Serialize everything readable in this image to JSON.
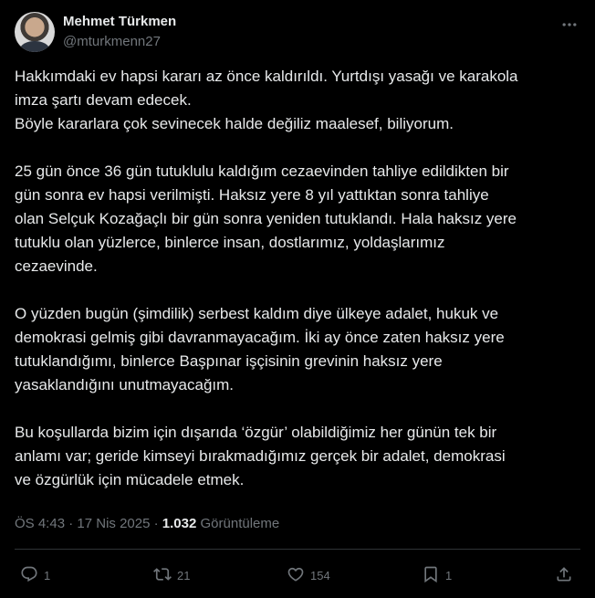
{
  "author": {
    "name": "Mehmet Türkmen",
    "handle": "@mturkmenn27"
  },
  "tweet": {
    "paragraphs": [
      "Hakkımdaki ev hapsi kararı az önce kaldırıldı. Yurtdışı yasağı ve karakola\nimza şartı devam edecek.\nBöyle kararlara çok sevinecek halde değiliz maalesef, biliyorum.",
      "25 gün önce 36 gün tutuklulu kaldığım cezaevinden tahliye edildikten bir\ngün sonra ev hapsi verilmişti. Haksız yere 8 yıl yattıktan sonra tahliye\nolan Selçuk Kozağaçlı bir gün sonra yeniden tutuklandı. Hala haksız yere\ntutuklu olan yüzlerce, binlerce insan, dostlarımız, yoldaşlarımız\ncezaevinde.",
      "O yüzden bugün (şimdilik) serbest kaldım diye ülkeye adalet, hukuk ve\ndemokrasi gelmiş gibi davranmayacağım. İki ay önce zaten haksız yere\ntutuklandığımı, binlerce Başpınar işçisinin grevinin haksız yere\nyasaklandığını unutmayacağım.",
      "Bu koşullarda bizim için dışarıda ‘özgür’ olabildiğimiz her günün tek bir\nanlamı var; geride kimseyi bırakmadığımız gerçek bir adalet,  demokrasi\nve özgürlük için mücadele etmek."
    ],
    "time": "ÖS 4:43",
    "date": "17 Nis 2025",
    "separator": "·",
    "views_count": "1.032",
    "views_label": "Görüntüleme"
  },
  "actions": {
    "reply": {
      "icon": "reply-icon",
      "count": "1"
    },
    "retweet": {
      "icon": "retweet-icon",
      "count": "21"
    },
    "like": {
      "icon": "heart-icon",
      "count": "154"
    },
    "bookmark": {
      "icon": "bookmark-icon",
      "count": "1"
    },
    "share": {
      "icon": "share-icon"
    }
  },
  "colors": {
    "background": "#000000",
    "text": "#e7e9ea",
    "secondary": "#71767b",
    "divider": "#2f3336"
  }
}
